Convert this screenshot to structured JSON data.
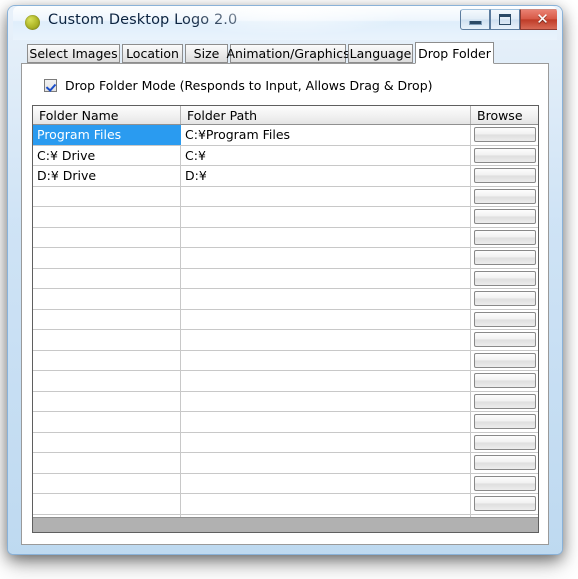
{
  "window": {
    "title": "Custom Desktop Logo 2.0",
    "icon": "app-logo-circle-icon",
    "controls": {
      "minimize_label": "—",
      "maximize_label": "□",
      "close_label": "✕"
    },
    "accent_color": "#2a9bf0",
    "titlebar_color": "#e9f3fc",
    "close_button_color": "#c2412c"
  },
  "tabs": [
    {
      "label": "Select Images",
      "active": false
    },
    {
      "label": "Location",
      "active": false
    },
    {
      "label": "Size",
      "active": false
    },
    {
      "label": "Animation/Graphics",
      "active": false
    },
    {
      "label": "Language",
      "active": false
    },
    {
      "label": "Drop Folder",
      "active": true
    }
  ],
  "drop_folder_mode": {
    "label": "Drop Folder Mode (Responds to Input, Allows Drag & Drop)",
    "checked": true
  },
  "grid": {
    "columns": [
      "Folder Name",
      "Folder Path",
      "Browse"
    ],
    "browse_button_label": "",
    "total_rows": 21,
    "rows": [
      {
        "name": "Program Files",
        "path": "C:¥Program Files",
        "selected": true
      },
      {
        "name": "C:¥ Drive",
        "path": "C:¥",
        "selected": false
      },
      {
        "name": "D:¥ Drive",
        "path": "D:¥",
        "selected": false
      },
      {
        "name": "",
        "path": "",
        "selected": false
      },
      {
        "name": "",
        "path": "",
        "selected": false
      },
      {
        "name": "",
        "path": "",
        "selected": false
      },
      {
        "name": "",
        "path": "",
        "selected": false
      },
      {
        "name": "",
        "path": "",
        "selected": false
      },
      {
        "name": "",
        "path": "",
        "selected": false
      },
      {
        "name": "",
        "path": "",
        "selected": false
      },
      {
        "name": "",
        "path": "",
        "selected": false
      },
      {
        "name": "",
        "path": "",
        "selected": false
      },
      {
        "name": "",
        "path": "",
        "selected": false
      },
      {
        "name": "",
        "path": "",
        "selected": false
      },
      {
        "name": "",
        "path": "",
        "selected": false
      },
      {
        "name": "",
        "path": "",
        "selected": false
      },
      {
        "name": "",
        "path": "",
        "selected": false
      },
      {
        "name": "",
        "path": "",
        "selected": false
      },
      {
        "name": "",
        "path": "",
        "selected": false
      },
      {
        "name": "",
        "path": "",
        "selected": false
      },
      {
        "name": "",
        "path": "",
        "selected": false
      }
    ]
  }
}
